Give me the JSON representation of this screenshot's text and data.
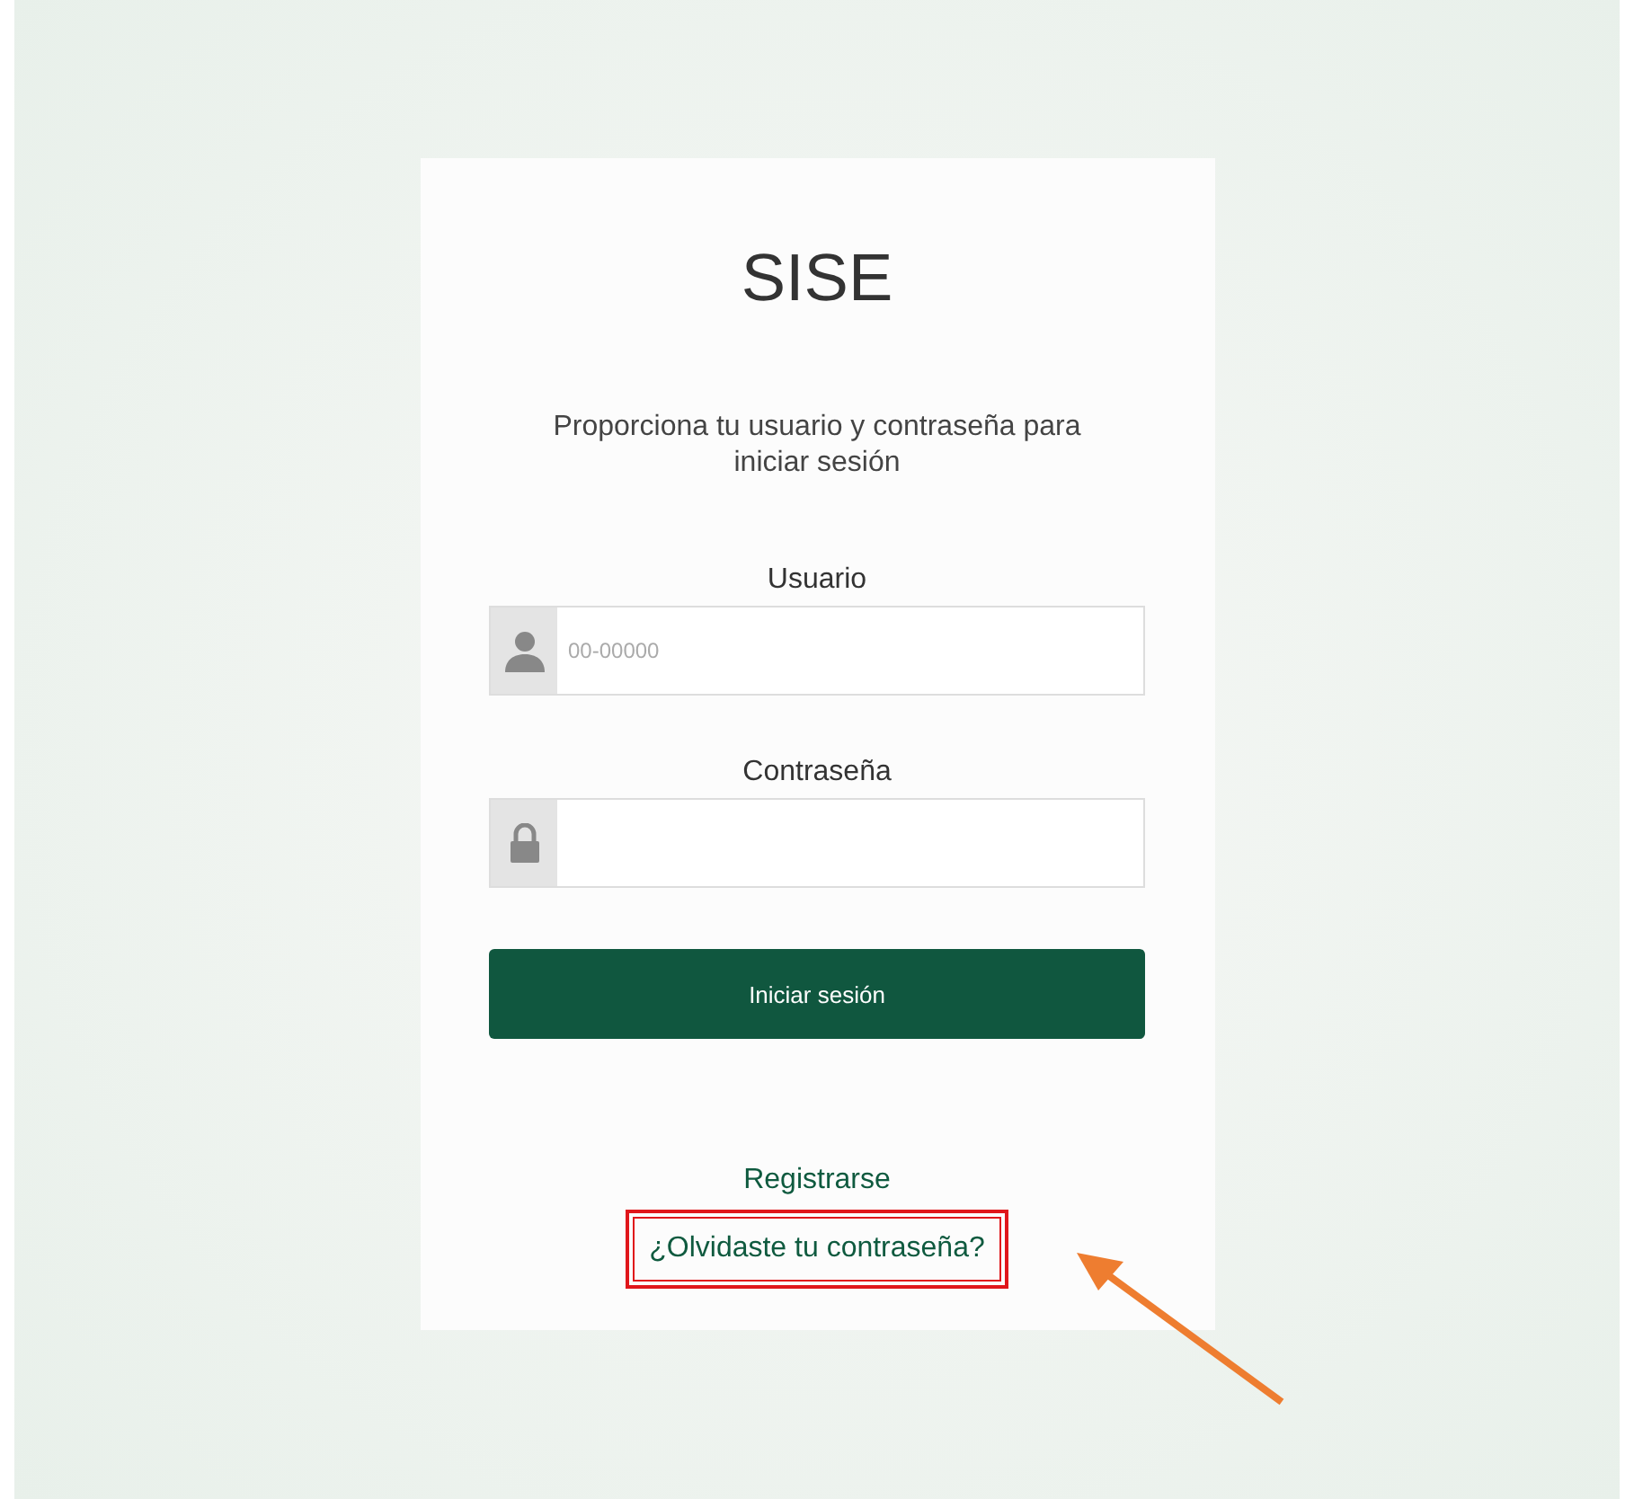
{
  "login": {
    "title": "SISE",
    "instructions": "Proporciona tu usuario y contraseña para iniciar sesión",
    "fields": [
      {
        "kind": "user",
        "label": "Usuario",
        "placeholder": "00-00000"
      },
      {
        "kind": "password",
        "label": "Contraseña"
      }
    ],
    "submit": "Iniciar sesión",
    "links": [
      {
        "label": "Registrarse",
        "highlighted": false
      },
      {
        "label": "¿Olvidaste tu contraseña?",
        "highlighted": true
      }
    ]
  },
  "annotation": {
    "arrow": true
  }
}
